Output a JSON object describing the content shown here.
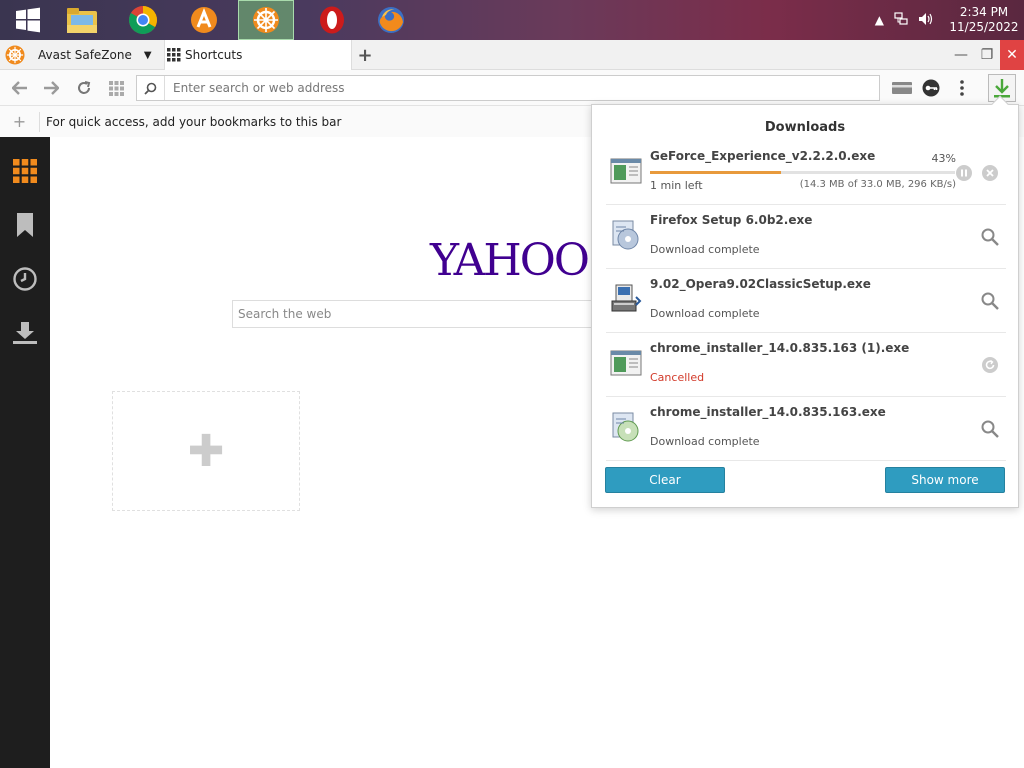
{
  "taskbar": {
    "apps": [
      {
        "name": "windows-start",
        "active": false
      },
      {
        "name": "file-explorer",
        "active": false
      },
      {
        "name": "chrome",
        "active": false
      },
      {
        "name": "avast",
        "active": false
      },
      {
        "name": "avast-safezone",
        "active": true
      },
      {
        "name": "opera",
        "active": false
      },
      {
        "name": "firefox",
        "active": false
      }
    ],
    "time": "2:34 PM",
    "date": "11/25/2022"
  },
  "tabs": [
    {
      "label": "Avast SafeZone"
    },
    {
      "label": "Shortcuts"
    }
  ],
  "navbar": {
    "address_placeholder": "Enter search or web address"
  },
  "bookmarks": {
    "message": "For quick access, add your bookmarks to this bar"
  },
  "content": {
    "logo": "YAHOO!",
    "search_placeholder": "Search the web"
  },
  "downloads": {
    "title": "Downloads",
    "items": [
      {
        "name": "GeForce_Experience_v2.2.2.0.exe",
        "status": "1 min left",
        "percent": "43%",
        "progress": 0.43,
        "detail": "(14.3 MB of 33.0 MB, 296 KB/s)",
        "state": "downloading"
      },
      {
        "name": "Firefox Setup 6.0b2.exe",
        "status": "Download complete",
        "state": "complete"
      },
      {
        "name": "9.02_Opera9.02ClassicSetup.exe",
        "status": "Download complete",
        "state": "complete"
      },
      {
        "name": "chrome_installer_14.0.835.163 (1).exe",
        "status": "Cancelled",
        "state": "cancelled"
      },
      {
        "name": "chrome_installer_14.0.835.163.exe",
        "status": "Download complete",
        "state": "complete"
      }
    ],
    "clear_label": "Clear",
    "show_more_label": "Show more"
  },
  "colors": {
    "accent": "#2f9cc0",
    "progress": "#e89a3c",
    "cancelled": "#d23a2a",
    "yahoo": "#400090"
  }
}
